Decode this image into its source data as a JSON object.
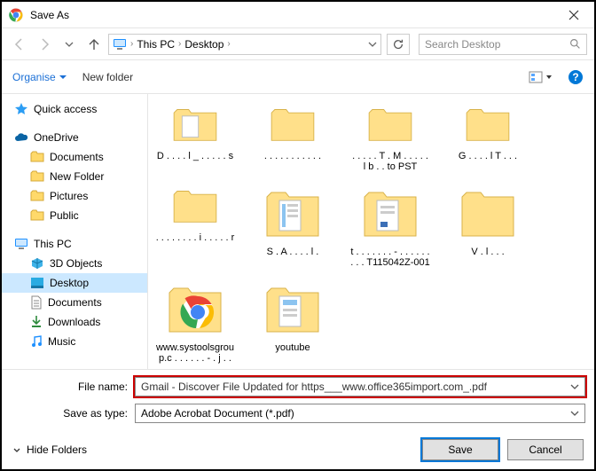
{
  "titlebar": {
    "title": "Save As"
  },
  "breadcrumb": {
    "part1": "This PC",
    "part2": "Desktop"
  },
  "search": {
    "placeholder": "Search Desktop"
  },
  "toolbar": {
    "organise": "Organise",
    "newfolder": "New folder"
  },
  "nav": {
    "quick": "Quick access",
    "onedrive": "OneDrive",
    "documents": "Documents",
    "newfolder": "New Folder",
    "pictures": "Pictures",
    "public": "Public",
    "thispc": "This PC",
    "objects3d": "3D Objects",
    "desktop": "Desktop",
    "documents2": "Documents",
    "downloads": "Downloads",
    "music": "Music"
  },
  "items": {
    "i1": "D . . . . l _ . . . . . s",
    "i2": ". . . . . . . . . . .",
    "i3": ". . . . . T . M . . . . . l b . . to PST",
    "i4": "G . . . . l T . . .",
    "i5": ". . . . . . . . i . . . . . r",
    "i6": "S . A . . . . l .",
    "i7": "t . . . . . . . - . . . . . . . . . T115042Z-001",
    "i8": "V . l . . .",
    "i9": "www.systoolsgroup.c . . . . . . - . j . .",
    "i10": "youtube"
  },
  "form": {
    "filename_label": "File name:",
    "filename_value": "Gmail - Discover File Updated for https___www.office365import.com_.pdf",
    "savetype_label": "Save as type:",
    "savetype_value": "Adobe Acrobat Document (*.pdf)"
  },
  "buttons": {
    "hide": "Hide Folders",
    "save": "Save",
    "cancel": "Cancel"
  }
}
